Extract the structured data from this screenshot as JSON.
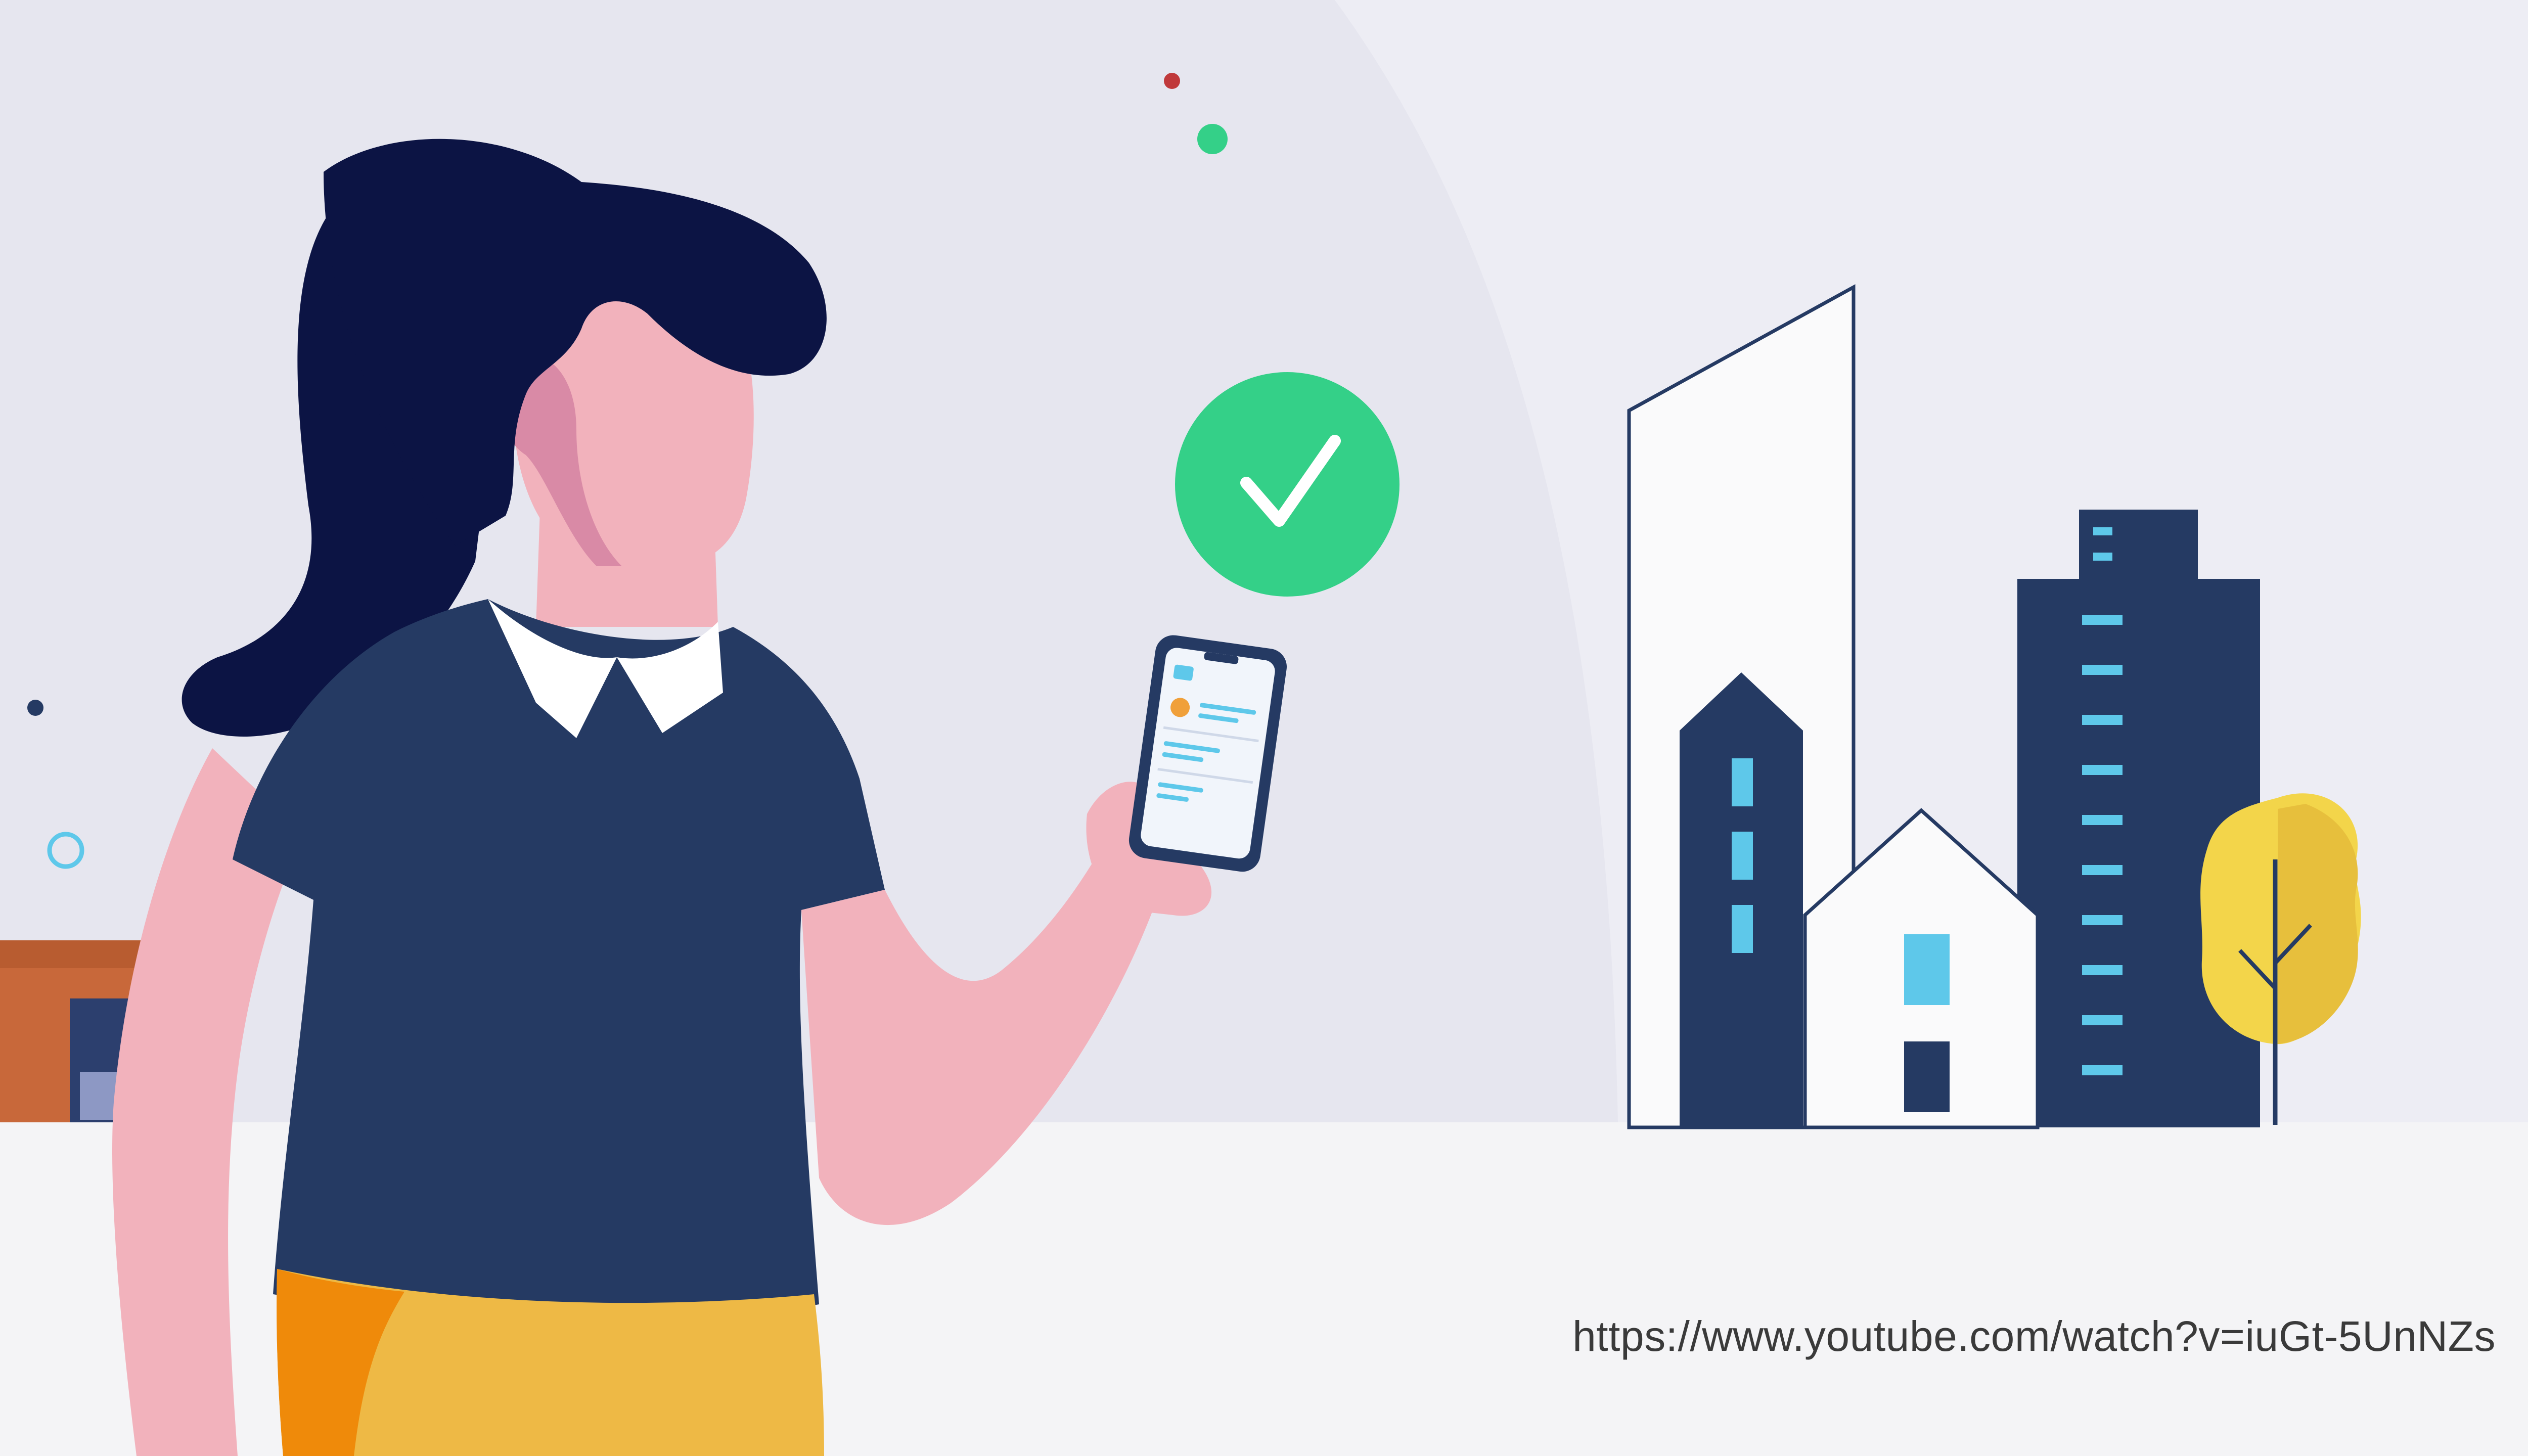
{
  "caption": {
    "source_url": "https://www.youtube.com/watch?v=iuGt-5UnNZs"
  },
  "illustration": {
    "subject": "person holding phone with verification check",
    "icons": [
      "check-circle-icon",
      "smartphone-icon",
      "tree-icon",
      "building-icon",
      "house-icon"
    ],
    "colors": {
      "background": "#ededf4",
      "ground": "#f4f4f6",
      "navy": "#253a63",
      "hair": "#0c1444",
      "skin": "#f2b2bc",
      "skin_shadow": "#d98aa6",
      "check_green": "#34d088",
      "window_blue": "#5ec8ea",
      "tree_yellow": "#f3d54a",
      "pants_yellow": "#eeb945",
      "pants_orange": "#ef8a0a",
      "brick": "#c8683a"
    }
  }
}
